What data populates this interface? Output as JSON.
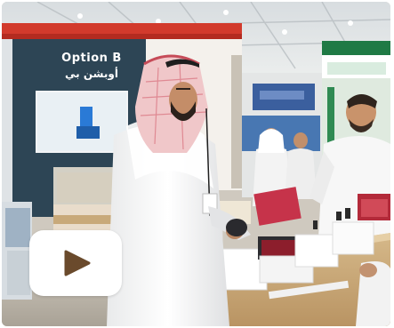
{
  "booth_sign": {
    "english": "Option B",
    "arabic": "أوبشن بي"
  },
  "video": {
    "play_icon": "play-icon",
    "button_color": "#ffffff",
    "icon_color": "#6a4a2c"
  }
}
